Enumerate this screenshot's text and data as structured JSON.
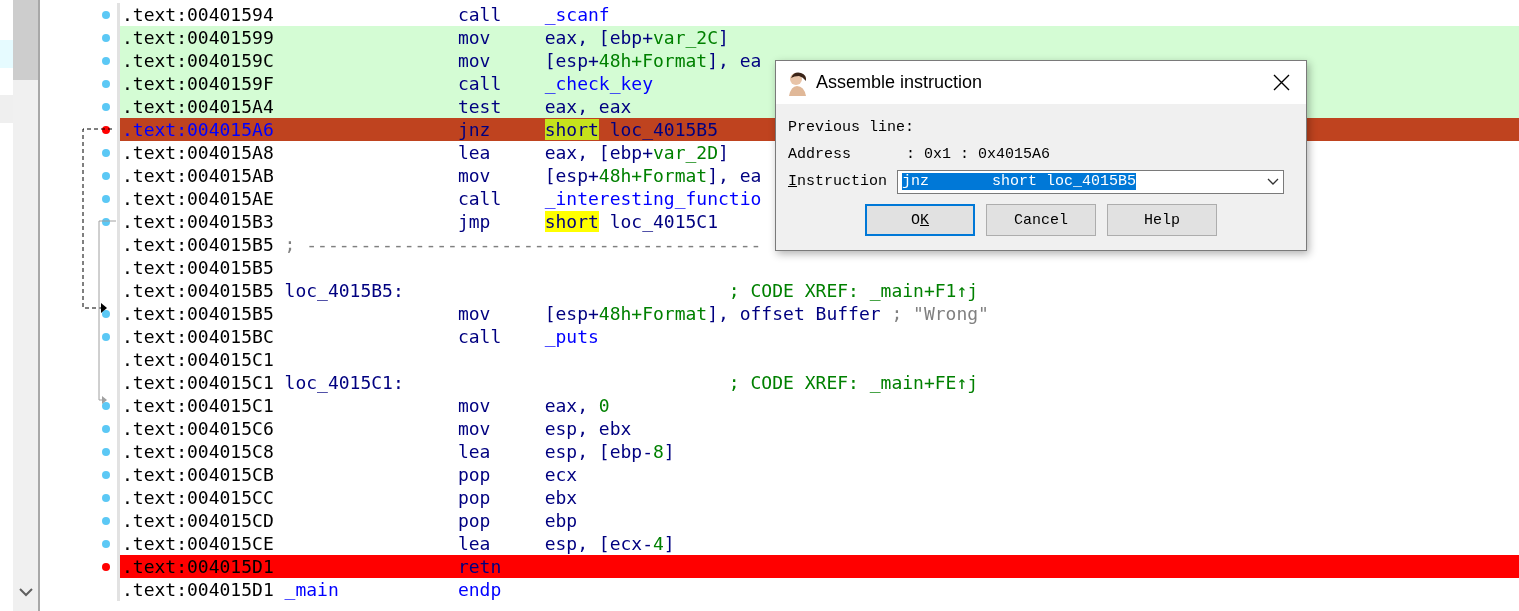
{
  "listing": [
    {
      "address": ".text:00401594",
      "kind": "plain",
      "color": "#5bc8f5",
      "mnemonic": "call",
      "operands": [
        {
          "text": "_scanf",
          "kind": "function"
        }
      ]
    },
    {
      "address": ".text:00401599",
      "kind": "executed",
      "color": "#5bc8f5",
      "mnemonic": "mov",
      "operands": [
        {
          "text": "eax, [ebp+",
          "kind": "text"
        },
        {
          "text": "var_2C",
          "kind": "constant"
        },
        {
          "text": "]",
          "kind": "text"
        }
      ]
    },
    {
      "address": ".text:0040159C",
      "kind": "executed",
      "color": "#5bc8f5",
      "mnemonic": "mov",
      "operands": [
        {
          "text": "[esp+",
          "kind": "text"
        },
        {
          "text": "48h+Format",
          "kind": "constant"
        },
        {
          "text": "], ea",
          "kind": "text"
        }
      ]
    },
    {
      "address": ".text:0040159F",
      "kind": "executed",
      "color": "#5bc8f5",
      "mnemonic": "call",
      "operands": [
        {
          "text": "_check_key",
          "kind": "function"
        }
      ]
    },
    {
      "address": ".text:004015A4",
      "kind": "executed",
      "color": "#5bc8f5",
      "mnemonic": "test",
      "operands": [
        {
          "text": "eax, eax",
          "kind": "text"
        }
      ]
    },
    {
      "address": ".text:004015A6",
      "kind": "current",
      "color": "#ff0000",
      "mnemonic": "jnz",
      "operands": [
        {
          "text": "short",
          "kind": "current_highlight"
        },
        {
          "text": " loc_4015B5",
          "kind": "text"
        }
      ]
    },
    {
      "address": ".text:004015A8",
      "kind": "plain",
      "color": "#5bc8f5",
      "mnemonic": "lea",
      "operands": [
        {
          "text": "eax, [ebp+",
          "kind": "text"
        },
        {
          "text": "var_2D",
          "kind": "constant"
        },
        {
          "text": "]",
          "kind": "text"
        }
      ]
    },
    {
      "address": ".text:004015AB",
      "kind": "plain",
      "color": "#5bc8f5",
      "mnemonic": "mov",
      "operands": [
        {
          "text": "[esp+",
          "kind": "text"
        },
        {
          "text": "48h+Format",
          "kind": "constant"
        },
        {
          "text": "], ea",
          "kind": "text"
        }
      ]
    },
    {
      "address": ".text:004015AE",
      "kind": "plain",
      "color": "#5bc8f5",
      "mnemonic": "call",
      "operands": [
        {
          "text": "_interesting_functio",
          "kind": "function"
        }
      ]
    },
    {
      "address": ".text:004015B3",
      "kind": "plain",
      "color": "#5bc8f5",
      "mnemonic": "jmp",
      "operands": [
        {
          "text": "short",
          "kind": "highlight"
        },
        {
          "text": " loc_4015C1",
          "kind": "text"
        }
      ]
    },
    {
      "address": ".text:004015B5",
      "kind": "plain",
      "separator": "; ------------------------------------------"
    },
    {
      "address": ".text:004015B5",
      "kind": "plain"
    },
    {
      "address": ".text:004015B5",
      "kind": "plain",
      "label": {
        "text": "loc_4015B5:",
        "kind": "text"
      },
      "comment": {
        "text": "; CODE XREF: _main+F1↑j",
        "kind": "comment"
      }
    },
    {
      "address": ".text:004015B5",
      "kind": "plain",
      "color": "#5bc8f5",
      "mnemonic": "mov",
      "operands": [
        {
          "text": "[esp+",
          "kind": "text"
        },
        {
          "text": "48h+Format",
          "kind": "constant"
        },
        {
          "text": "], offset Buffer",
          "kind": "text"
        }
      ],
      "comment": {
        "text": "; \"Wrong\"",
        "kind": "string"
      }
    },
    {
      "address": ".text:004015BC",
      "kind": "plain",
      "color": "#5bc8f5",
      "mnemonic": "call",
      "operands": [
        {
          "text": "_puts",
          "kind": "function"
        }
      ]
    },
    {
      "address": ".text:004015C1",
      "kind": "plain"
    },
    {
      "address": ".text:004015C1",
      "kind": "plain",
      "label": {
        "text": "loc_4015C1:",
        "kind": "text"
      },
      "comment": {
        "text": "; CODE XREF: _main+FE↑j",
        "kind": "comment"
      }
    },
    {
      "address": ".text:004015C1",
      "kind": "plain",
      "color": "#5bc8f5",
      "mnemonic": "mov",
      "operands": [
        {
          "text": "eax, ",
          "kind": "text"
        },
        {
          "text": "0",
          "kind": "constant"
        }
      ]
    },
    {
      "address": ".text:004015C6",
      "kind": "plain",
      "color": "#5bc8f5",
      "mnemonic": "mov",
      "operands": [
        {
          "text": "esp, ebx",
          "kind": "text"
        }
      ]
    },
    {
      "address": ".text:004015C8",
      "kind": "plain",
      "color": "#5bc8f5",
      "mnemonic": "lea",
      "operands": [
        {
          "text": "esp, [ebp-",
          "kind": "text"
        },
        {
          "text": "8",
          "kind": "constant"
        },
        {
          "text": "]",
          "kind": "text"
        }
      ]
    },
    {
      "address": ".text:004015CB",
      "kind": "plain",
      "color": "#5bc8f5",
      "mnemonic": "pop",
      "operands": [
        {
          "text": "ecx",
          "kind": "text"
        }
      ]
    },
    {
      "address": ".text:004015CC",
      "kind": "plain",
      "color": "#5bc8f5",
      "mnemonic": "pop",
      "operands": [
        {
          "text": "ebx",
          "kind": "text"
        }
      ]
    },
    {
      "address": ".text:004015CD",
      "kind": "plain",
      "color": "#5bc8f5",
      "mnemonic": "pop",
      "operands": [
        {
          "text": "ebp",
          "kind": "text"
        }
      ]
    },
    {
      "address": ".text:004015CE",
      "kind": "plain",
      "color": "#5bc8f5",
      "mnemonic": "lea",
      "operands": [
        {
          "text": "esp, [ecx-",
          "kind": "text"
        },
        {
          "text": "4",
          "kind": "constant"
        },
        {
          "text": "]",
          "kind": "text"
        }
      ]
    },
    {
      "address": ".text:004015D1",
      "kind": "breakpoint",
      "color": "#ff0000",
      "mnemonic": "retn"
    },
    {
      "address": ".text:004015D1",
      "kind": "plain",
      "label": {
        "text": "_main",
        "kind": "function"
      },
      "directive": "endp"
    }
  ],
  "dialog": {
    "title": "Assemble instruction",
    "previous_line": "Previous line:",
    "address_label": "Address",
    "address_value": ": 0x1 : 0x4015A6",
    "instruction_label": {
      "access_key": "I",
      "text_after": "nstruction"
    },
    "instruction_value": "jnz       short loc_4015B5",
    "instruction_selected": true,
    "buttons": [
      {
        "label": {
          "text_before": "O",
          "access_key": "K"
        },
        "focused": true
      },
      {
        "label": {
          "text_before": "Cancel"
        },
        "focused": false
      },
      {
        "label": {
          "text_before": "Help"
        },
        "focused": false
      }
    ]
  }
}
